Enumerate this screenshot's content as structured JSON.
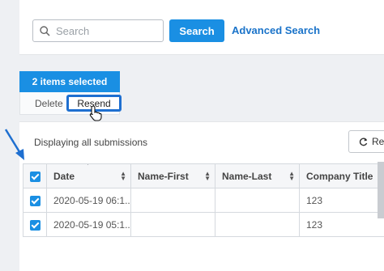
{
  "search": {
    "placeholder": "Search",
    "button_label": "Search",
    "advanced_link": "Advanced Search"
  },
  "selection": {
    "selected_label": "2 items selected",
    "actions": {
      "delete_label": "Delete",
      "resend_label": "Resend"
    }
  },
  "table_view": {
    "display_text": "Displaying all submissions",
    "refresh_label": "Re"
  },
  "table": {
    "columns": [
      "Date",
      "Name-First",
      "Name-Last",
      "Company Title"
    ],
    "rows": [
      {
        "checked": true,
        "date": "2020-05-19 06:1...",
        "name_first": "",
        "name_last": "",
        "company_title": "123"
      },
      {
        "checked": true,
        "date": "2020-05-19 05:1...",
        "name_first": "",
        "name_last": "",
        "company_title": "123"
      }
    ]
  },
  "colors": {
    "accent": "#1a8fe3",
    "link": "#1a73c9",
    "highlight_border": "#1e6fd0"
  },
  "icons": [
    "search-icon",
    "refresh-icon",
    "sort-icon",
    "pointer-cursor-icon",
    "annotation-arrow-icon"
  ]
}
